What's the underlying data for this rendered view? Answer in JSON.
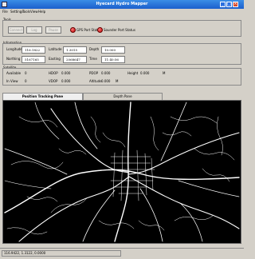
{
  "window": {
    "title": "Hyecard Hydro Mapper"
  },
  "menu": [
    "File",
    "Settings",
    "Tools",
    "View",
    "Help"
  ],
  "tools": {
    "label": "Tools",
    "buttons": [
      "Connect",
      "Log",
      "Pause"
    ],
    "indicators": [
      "GPS Port Status",
      "Sounder Port Status"
    ]
  },
  "information": {
    "label": "Information",
    "longitude": {
      "label": "Longitude",
      "value": "116.1822"
    },
    "latitude": {
      "label": "Latitude",
      "value": "1.3015"
    },
    "depth": {
      "label": "Depth",
      "value": "10.000"
    },
    "northing": {
      "label": "Northing",
      "value": "5167165"
    },
    "easting": {
      "label": "Easting",
      "value": "2068647"
    },
    "time": {
      "label": "Time",
      "value": "11:40:56"
    }
  },
  "satellite": {
    "label": "Satellite",
    "available": {
      "label": "Available",
      "value": "0"
    },
    "in_view": {
      "label": "In View",
      "value": "0"
    },
    "hdop": {
      "label": "HDOP",
      "value": "0.000"
    },
    "vdop": {
      "label": "VDOP",
      "value": "0.000"
    },
    "pdop": {
      "label": "PDOP",
      "value": "0.000"
    },
    "altitude": {
      "label": "Altitude",
      "value": "0.000"
    },
    "altitude_unit": "M",
    "height": {
      "label": "Height",
      "value": "0.000"
    },
    "height_unit": "M"
  },
  "tabs": {
    "position": "Position Tracking Pane",
    "depth": "Depth Pane"
  },
  "status": {
    "coords": "116.9422, 1.3122, 0.0000"
  },
  "colors": {
    "titlebar": "#1b5fcc",
    "map_bg": "#000000",
    "roads": "#ffffff",
    "led_off": "#c00000"
  }
}
